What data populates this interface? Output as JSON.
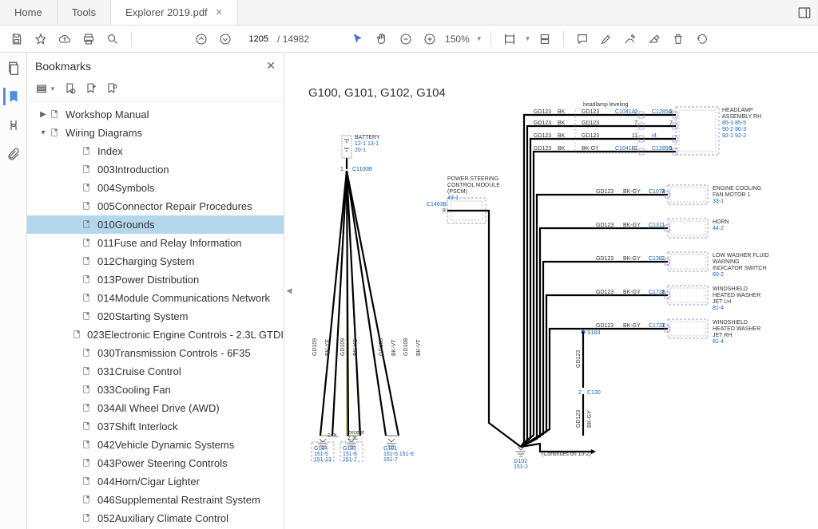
{
  "tabs": {
    "home": "Home",
    "tools": "Tools",
    "doc": "Explorer 2019.pdf"
  },
  "toolbar": {
    "page_current": "1205",
    "page_total": "/ 14982",
    "zoom": "150%"
  },
  "panel": {
    "title": "Bookmarks"
  },
  "tree": {
    "root1": "Workshop Manual",
    "root2": "Wiring Diagrams",
    "items": [
      "Index",
      "003Introduction",
      "004Symbols",
      "005Connector Repair Procedures",
      "010Grounds",
      "011Fuse and Relay Information",
      "012Charging System",
      "013Power Distribution",
      "014Module Communications Network",
      "020Starting System",
      "023Electronic Engine Controls - 2.3L GTDI",
      "030Transmission Controls - 6F35",
      "031Cruise Control",
      "033Cooling Fan",
      "034All Wheel Drive (AWD)",
      "037Shift Interlock",
      "042Vehicle Dynamic Systems",
      "043Power Steering Controls",
      "044Horn/Cigar Lighter",
      "046Supplemental Restraint System",
      "052Auxiliary Climate Control"
    ],
    "selected_index": 4
  },
  "doc": {
    "heading": "G100, G101, G102, G104",
    "battery": {
      "label": "BATTERY",
      "refs": [
        "12-1",
        "13-1",
        "20-1"
      ]
    },
    "c1100b": "C1100B",
    "left_runs": {
      "gd109a": "GD109",
      "gd109b": "GD109",
      "gd108a": "GD108",
      "gd108b": "GD108",
      "bkye1": "BK-YE",
      "bkye2": "BK-YE",
      "bkvt1": "BK-VT",
      "bkvt2": "BK-VT"
    },
    "left_grounds": {
      "note1": "2.3L",
      "note2": "except 2.3L",
      "g104": {
        "name": "G104",
        "a": "151-5",
        "b": "151-13"
      },
      "g100": {
        "name": "G100",
        "a": "151-6",
        "b": "151-7"
      },
      "g101": {
        "name": "G101",
        "a": "151-5",
        "b": "151-6",
        "c": "151-7"
      }
    },
    "pscm": {
      "label": "POWER STEERING CONTROL MODULE (PSCM)",
      "ref": "43-1",
      "conn": "C1463B",
      "pin": "8"
    },
    "headlamp_group": "headlamp leveling",
    "right_header": [
      {
        "w": "GD123",
        "c": "BK",
        "mid": "GD123",
        "conn": "C1041A",
        "pin": "2",
        "end": "C1285A",
        "epin": "2"
      },
      {
        "w": "GD123",
        "c": "BK",
        "mid": "GD123",
        "pin": "7",
        "epin": "7"
      },
      {
        "w": "GD123",
        "c": "BK",
        "mid": "GD123",
        "conn": "",
        "pin": "11",
        "end": "I4",
        "epin": ""
      },
      {
        "w": "GD123",
        "c": "BK",
        "mid": "BK-GY",
        "conn": "C1041B",
        "pin": "1",
        "end": "C1285B",
        "epin": "1"
      }
    ],
    "right_rows": [
      {
        "w": "GD123",
        "c": "BK-GY",
        "conn": "C1074",
        "pin": "2",
        "module": "ENGINE COOLING FAN MOTOR 1",
        "ref": "33-1"
      },
      {
        "w": "GD123",
        "c": "BK-GY",
        "conn": "C131",
        "pin": "1",
        "module": "HORN",
        "ref": "44-2"
      },
      {
        "w": "GD123",
        "c": "BK-GY",
        "conn": "C138",
        "pin": "2",
        "module": "LOW WASHER FLUID WARNING INDICATOR SWITCH",
        "ref": "60-2"
      },
      {
        "w": "GD123",
        "c": "BK-GY",
        "conn": "C1738",
        "pin": "1",
        "module": "WINDSHIELD HEATED WASHER JET LH",
        "ref": "81-4"
      },
      {
        "w": "GD123",
        "c": "BK-GY",
        "conn": "C1737",
        "pin": "1",
        "module": "WINDSHIELD HEATED WASHER JET RH",
        "ref": "81-4"
      }
    ],
    "headlamp_module": {
      "label": "HEADLAMP ASSEMBLY RH",
      "refs": [
        "85-3  85-5",
        "90-2  90-3",
        "92-1  92-2"
      ]
    },
    "splice": "S183",
    "g102": {
      "name": "G102",
      "ref": "151-2"
    },
    "continues": "(Continues on 10-2)",
    "tail": {
      "w": "GD123",
      "c": "BK-GY",
      "conn": "C130",
      "pin": "2"
    },
    "tail_v": {
      "w1": "GD123",
      "w2": "GD123"
    }
  }
}
